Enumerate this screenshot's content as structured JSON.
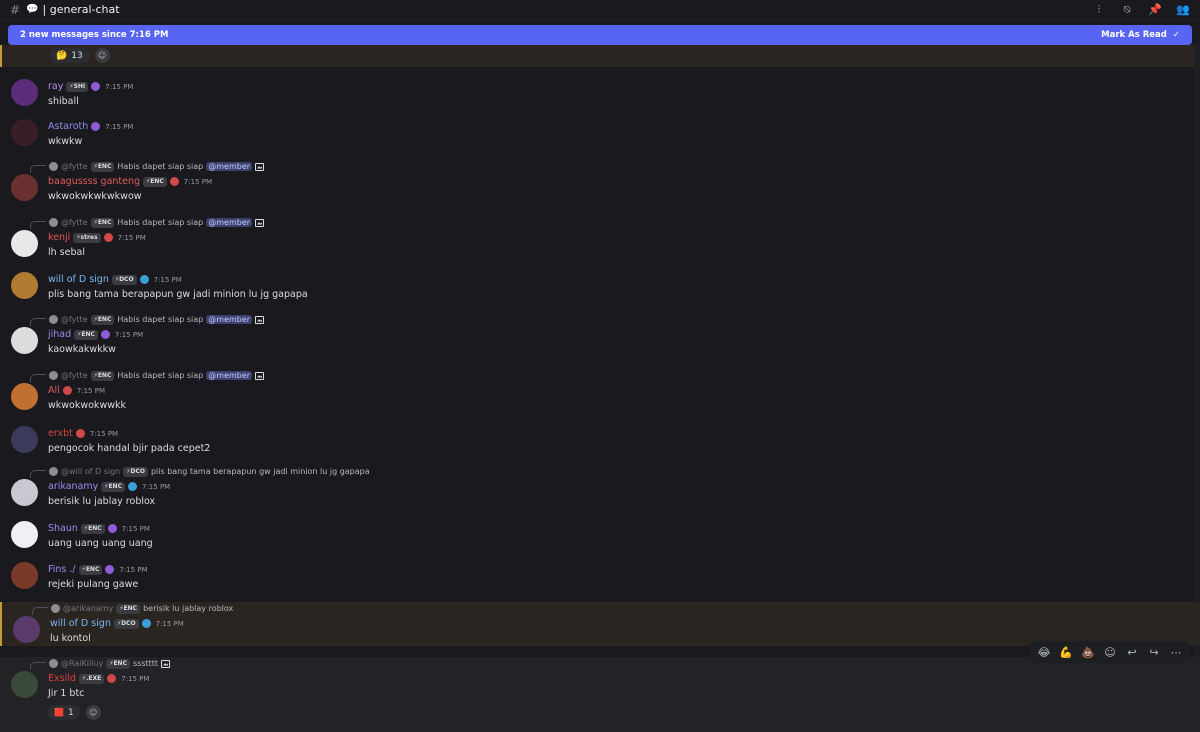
{
  "topbar": {
    "channel": "| general-chat"
  },
  "banner": {
    "text": "2 new messages since 7:16 PM",
    "mark_read": "Mark As Read"
  },
  "prev_reaction": {
    "count": "13"
  },
  "messages": [
    {
      "name": "ray",
      "tag": "SHI",
      "time": "7:15 PM",
      "text": "shiball",
      "name_color": "#b78ef0"
    },
    {
      "name": "Astaroth",
      "time": "7:15 PM",
      "text": "wkwkw",
      "name_color": "#8b8cf0"
    },
    {
      "reply": {
        "name": "@fytte",
        "tag": "ENC",
        "text": "Habis dapet siap siap",
        "mention": "@member"
      },
      "name": "baagussss ganteng",
      "tag": "ENC",
      "time": "7:15 PM",
      "text": "wkwokwkwkwkwow",
      "name_color": "#e05a5a"
    },
    {
      "reply": {
        "name": "@fytte",
        "tag": "ENC",
        "text": "Habis dapet siap siap",
        "mention": "@member"
      },
      "name": "kenji",
      "tag": "stres",
      "time": "7:15 PM",
      "text": "lh sebal",
      "name_color": "#e05a5a"
    },
    {
      "name": "will of D sign",
      "tag": "DCO",
      "time": "7:15 PM",
      "text": "plis bang tama berapapun gw jadi minion lu jg gapapa",
      "name_color": "#7ab8f5"
    },
    {
      "reply": {
        "name": "@fytte",
        "tag": "ENC",
        "text": "Habis dapet siap siap",
        "mention": "@member"
      },
      "name": "jihad",
      "tag": "ENC",
      "time": "7:15 PM",
      "text": "kaowkakwkkw",
      "name_color": "#9b8cf0"
    },
    {
      "reply": {
        "name": "@fytte",
        "tag": "ENC",
        "text": "Habis dapet siap siap",
        "mention": "@member"
      },
      "name": "All",
      "time": "7:15 PM",
      "text": "wkwokwokwwkk",
      "name_color": "#e05a5a"
    },
    {
      "name": "erxbt",
      "time": "7:15 PM",
      "text": "pengocok handal bjir pada cepet2",
      "name_color": "#d04848"
    },
    {
      "reply": {
        "name": "@will of D sign",
        "tag": "DCO",
        "text": "plis bang tama berapapun gw jadi minion lu jg gapapa"
      },
      "name": "arikanamy",
      "tag": "ENC",
      "time": "7:15 PM",
      "text": "berisik lu jablay roblox",
      "name_color": "#9b8cf0"
    },
    {
      "name": "Shaun",
      "tag": "ENC",
      "time": "7:15 PM",
      "text": "uang uang uang uang",
      "name_color": "#9b8cf0"
    },
    {
      "name": "Fins ./",
      "tag": "ENC",
      "time": "7:15 PM",
      "text": "rejeki pulang gawe",
      "name_color": "#9b8cf0"
    },
    {
      "reply": {
        "name": "@arikanamy",
        "tag": "ENC",
        "text": "berisik lu jablay roblox"
      },
      "name": "will of D sign",
      "tag": "DCO",
      "time": "7:15 PM",
      "text": "lu kontol",
      "name_color": "#7ab8f5"
    },
    {
      "reply": {
        "name": "@RaiKilluy",
        "tag": "ENC",
        "text": "ssstttt"
      },
      "name": "Exsild",
      "tag": ".EXE",
      "time": "7:15 PM",
      "text": "Jir 1 btc",
      "name_color": "#e03c3c",
      "reaction_count": "1"
    }
  ]
}
